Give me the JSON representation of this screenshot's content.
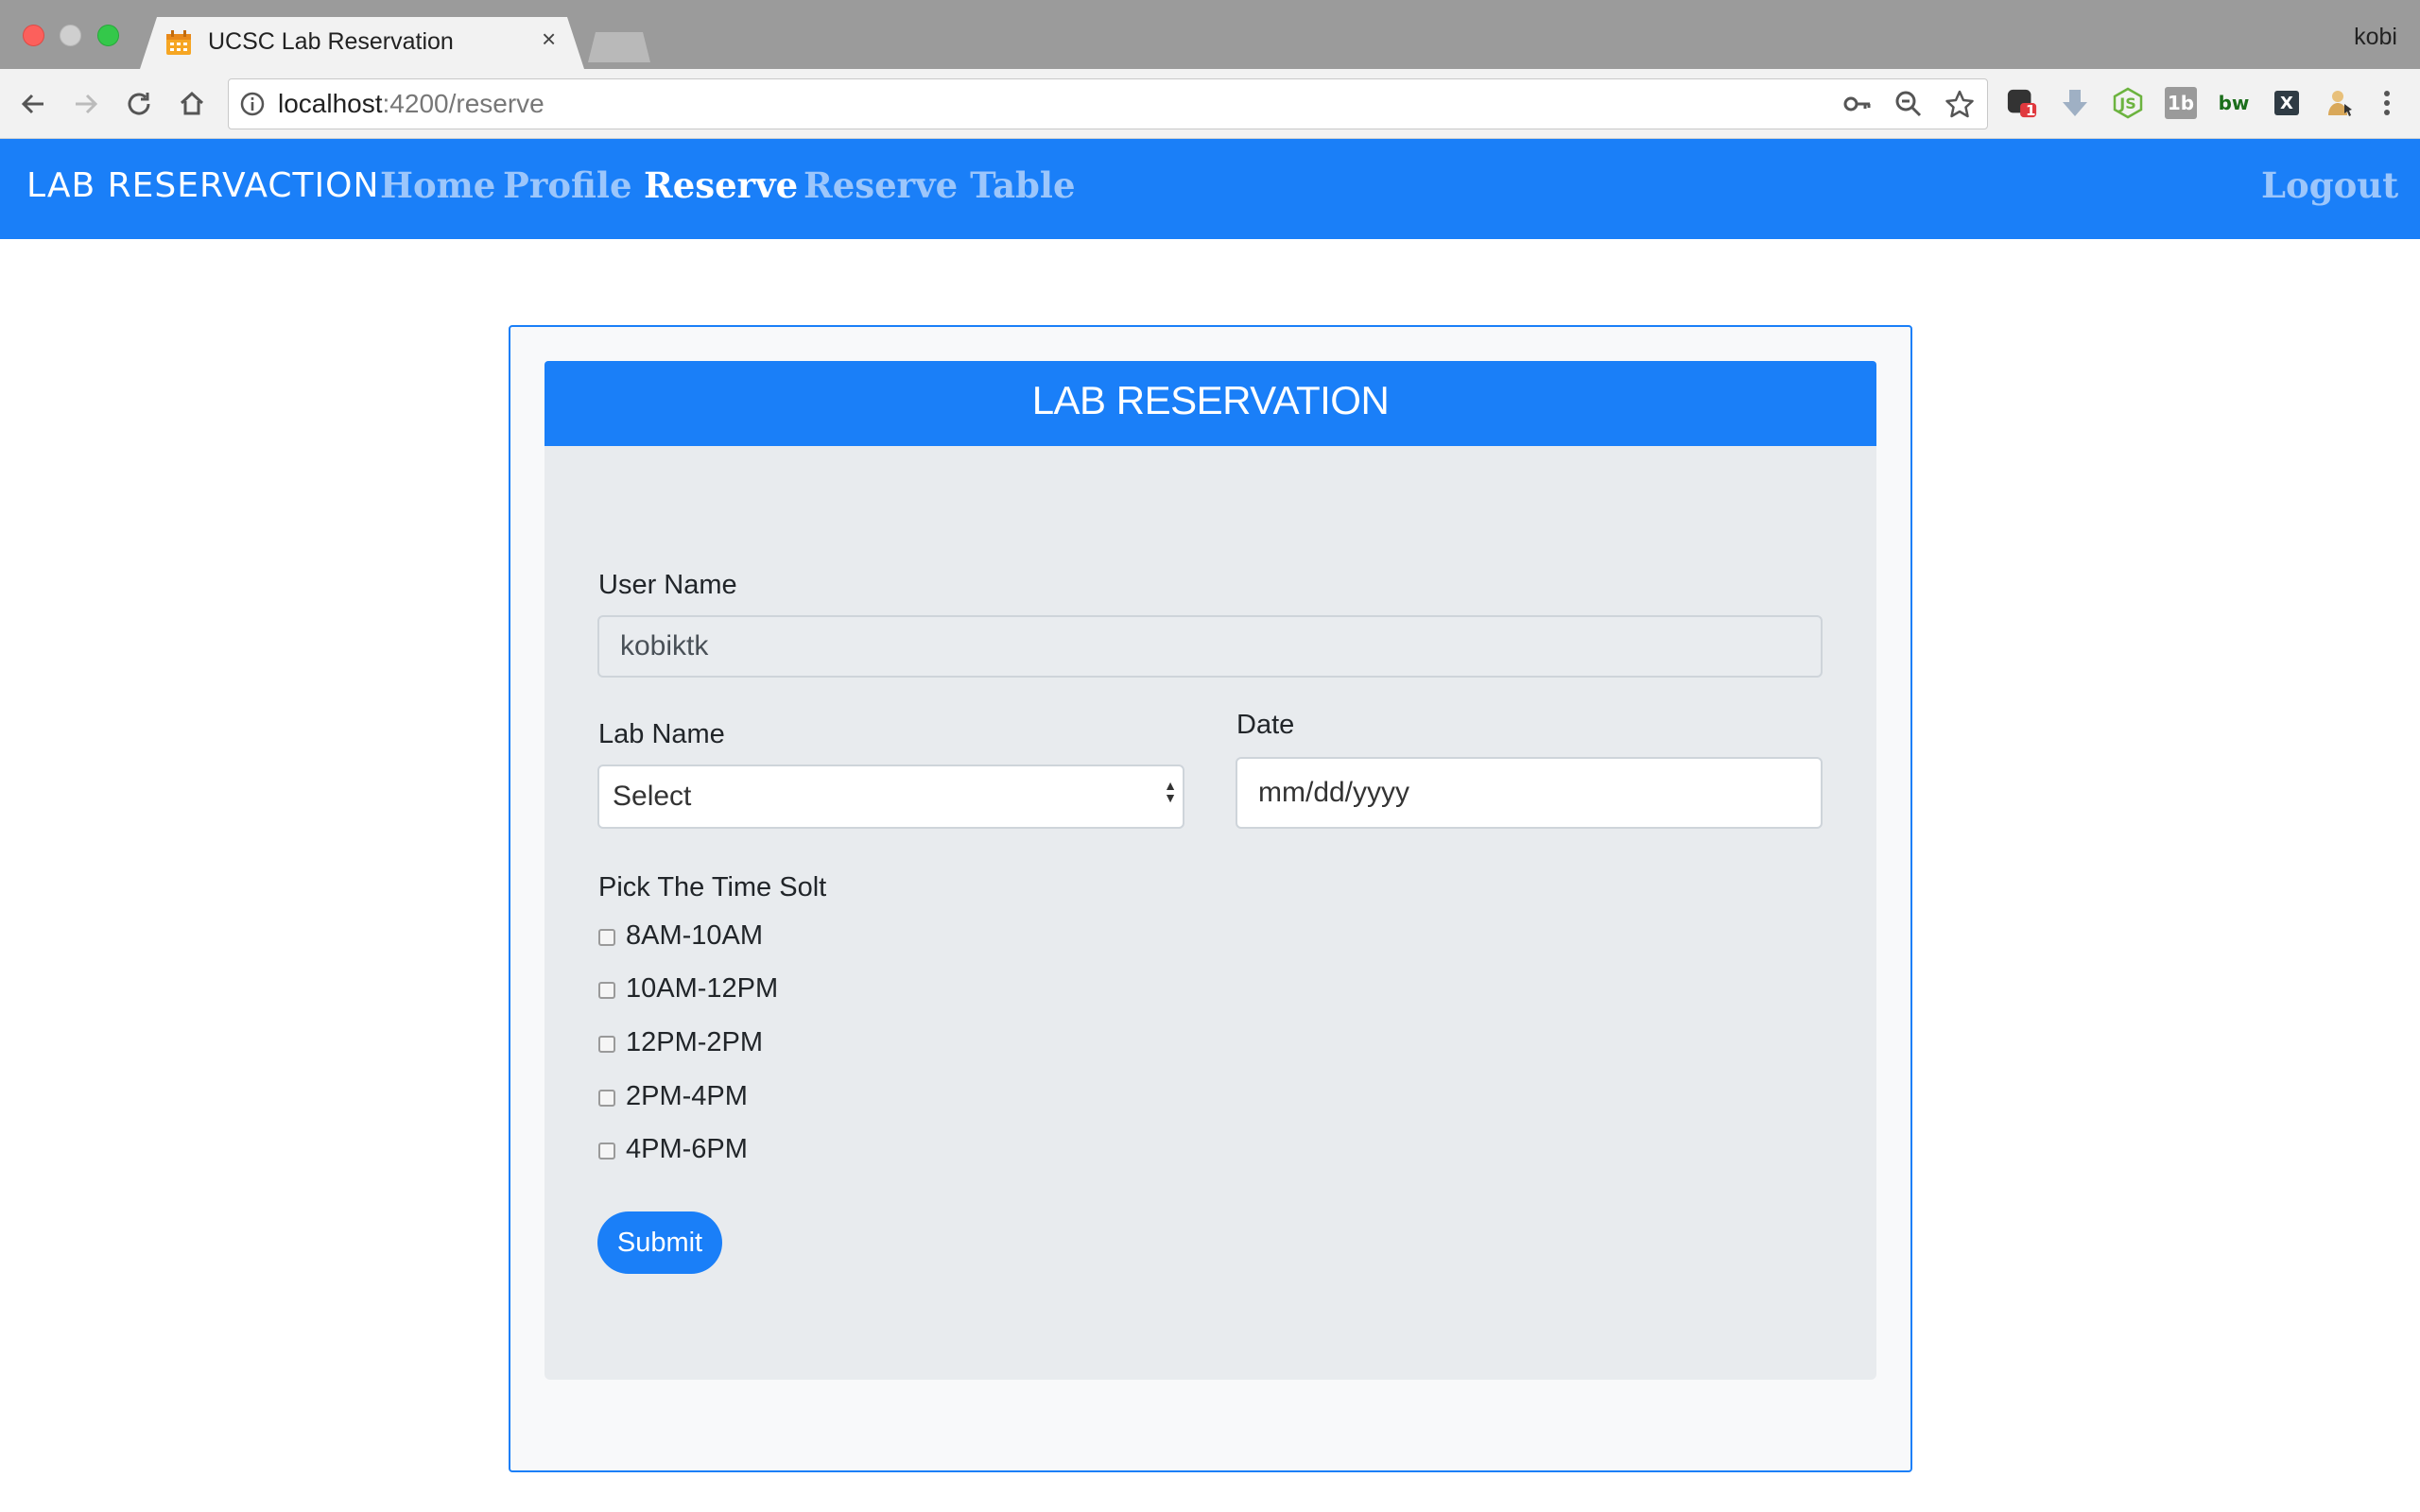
{
  "browser": {
    "tab_title": "UCSC Lab Reservation",
    "tab_close": "×",
    "profile_name": "kobi",
    "url_host": "localhost",
    "url_path": ":4200/reserve",
    "extensions": [
      {
        "name": "pocket",
        "badge": "1"
      },
      {
        "name": "download-arrow",
        "text": ""
      },
      {
        "name": "nodejs",
        "text": "JS"
      },
      {
        "name": "onetab",
        "text": "1b"
      },
      {
        "name": "bw",
        "text": "bw"
      },
      {
        "name": "x-ext",
        "text": "X"
      }
    ]
  },
  "navbar": {
    "brand": "LAB RESERVACTION",
    "links": [
      "Home",
      "Profile",
      "Reserve",
      "Reserve Table"
    ],
    "active": "Reserve",
    "logout": "Logout"
  },
  "form": {
    "title": "LAB RESERVATION",
    "username_label": "User Name",
    "username_value": "kobiktk",
    "labname_label": "Lab Name",
    "labname_selected": "Select",
    "date_label": "Date",
    "date_placeholder": "mm/dd/yyyy",
    "timeslot_label": "Pick The Time Solt",
    "timeslots": [
      "8AM-10AM",
      "10AM-12PM",
      "12PM-2PM",
      "2PM-4PM",
      "4PM-6PM"
    ],
    "submit_label": "Submit"
  },
  "colors": {
    "primary": "#1a7ff8",
    "nav_inactive": "#9cc6fb",
    "card_body": "#e8ebee"
  }
}
